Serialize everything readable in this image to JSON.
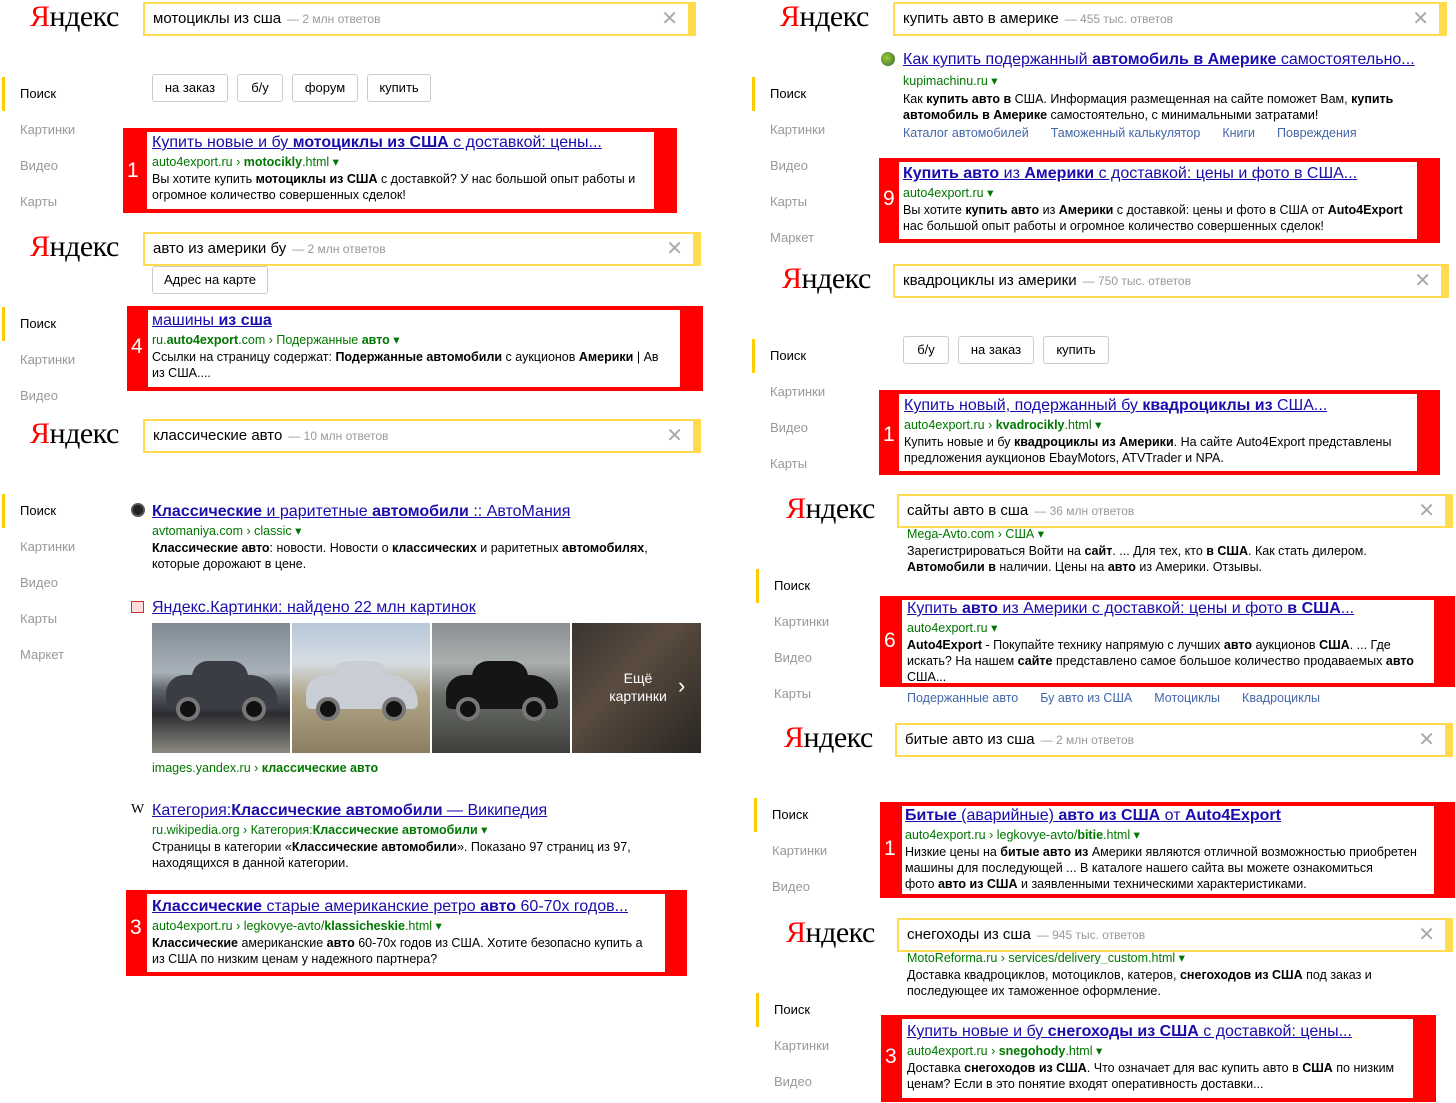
{
  "brand": {
    "logo": "Яндекс",
    "logo_first": "Я",
    "logo_rest": "ндекс"
  },
  "nav": {
    "search": "Поиск",
    "images": "Картинки",
    "video": "Видео",
    "maps": "Карты",
    "market": "Маркет"
  },
  "left": {
    "p1": {
      "query": "мотоциклы из сша",
      "count": "— 2 млн ответов",
      "chips": [
        "на заказ",
        "б/у",
        "форум",
        "купить"
      ],
      "res": {
        "rank": "1",
        "title_parts": [
          "Купить новые и бу ",
          "мотоциклы из США",
          " с доставкой: цены..."
        ],
        "url_parts": [
          "auto4export.ru › ",
          "motocikly",
          ".html ▾"
        ],
        "snippet1_parts": [
          "Вы хотите купить ",
          "мотоциклы из США",
          " с доставкой? У нас большой опыт работы и"
        ],
        "snippet2": "огромное количество совершенных сделок!"
      }
    },
    "p2": {
      "query": "авто из америки бу",
      "count": "— 2 млн ответов",
      "map_chip": "Адрес на карте",
      "res": {
        "rank": "4",
        "title_parts": [
          "машины ",
          "из сша"
        ],
        "url_parts": [
          "ru.",
          "auto4export",
          ".com › Подержанные ",
          "авто",
          " ▾"
        ],
        "snippet1_parts": [
          "Ссылки на страницу содержат: ",
          "Подержанные автомобили",
          " с аукционов ",
          "Америки",
          " | Ав"
        ],
        "snippet2": "из США...."
      }
    },
    "p3": {
      "query": "классические авто",
      "count": "— 10 млн ответов",
      "r1": {
        "title_parts": [
          "Классические",
          " и раритетные ",
          "автомобили",
          " :: АвтоМания"
        ],
        "url_parts": [
          "avtomaniya.com › classic ▾"
        ],
        "snippet1_parts": [
          "Классические авто",
          ": новости. Новости о ",
          "классических",
          " и раритетных ",
          "автомобилях",
          ","
        ],
        "snippet2": "которые дорожают в цене."
      },
      "r2": {
        "title": "Яндекс.Картинки: найдено 22 млн картинок",
        "more": "Ещё картинки",
        "more1": "Ещё",
        "more2": "картинки",
        "url_parts": [
          "images.yandex.ru › ",
          "классические авто"
        ]
      },
      "r3": {
        "title_parts": [
          "Категория:",
          "Классические автомобили",
          " — Википедия"
        ],
        "url_parts": [
          "ru.wikipedia.org › Категория:",
          "Классические автомобили",
          " ▾"
        ],
        "snippet1_parts": [
          "Страницы в категории «",
          "Классические автомобили",
          "». Показано 97 страниц из 97,"
        ],
        "snippet2": "находящихся в данной категории."
      },
      "r4": {
        "rank": "3",
        "title_parts": [
          "Классические",
          " старые американские ретро ",
          "авто",
          " 60-70х годов..."
        ],
        "url_parts": [
          "auto4export.ru › legkovye-avto/",
          "klassicheskie",
          ".html ▾"
        ],
        "snippet1_parts": [
          "Классические",
          " американские ",
          "авто",
          " 60-70х годов из США. Хотите безопасно купить а"
        ],
        "snippet2": "из США по низким ценам у надежного партнера?"
      }
    }
  },
  "right": {
    "p1": {
      "query": "купить авто в америке",
      "count": "— 455 тыс. ответов",
      "r1": {
        "title_parts": [
          "Как купить подержанный ",
          "автомобиль в Америке",
          " самостоятельно..."
        ],
        "url": "kupimachinu.ru ▾",
        "snippet1_parts": [
          "Как ",
          "купить авто в",
          " США. Информация размещенная на сайте поможет Вам, ",
          "купить"
        ],
        "snippet2_parts": [
          "автомобиль в Америке",
          " самостоятельно, с минимальными затратами!"
        ],
        "sitelinks": [
          "Каталог автомобилей",
          "Таможенный калькулятор",
          "Книги",
          "Повреждения"
        ]
      },
      "r2": {
        "rank": "9",
        "title_parts": [
          "Купить авто",
          " из ",
          "Америки",
          " с доставкой: цены и фото в США..."
        ],
        "url_parts": [
          "auto4export.ru ▾"
        ],
        "snippet1_parts": [
          "Вы хотите ",
          "купить авто",
          " из ",
          "Америки",
          " с доставкой: цены и фото в США от ",
          "Auto4Export"
        ],
        "snippet2": "нас большой опыт работы и огромное количество совершенных сделок!"
      }
    },
    "p2": {
      "query": "квадроциклы из америки",
      "count": "— 750 тыс. ответов",
      "chips": [
        "б/у",
        "на заказ",
        "купить"
      ],
      "res": {
        "rank": "1",
        "title_parts": [
          "Купить новый, подержанный бу ",
          "квадроциклы из",
          " США..."
        ],
        "url_parts": [
          "auto4export.ru › ",
          "kvadrocikly",
          ".html ▾"
        ],
        "snippet1_parts": [
          "Купить новые и бу ",
          "квадроциклы из Америки",
          ". На сайте Auto4Export представлены"
        ],
        "snippet2": "предложения аукционов EbayMotors, ATVTrader и NPA."
      }
    },
    "p3": {
      "query": "сайты авто в сша",
      "count": "— 36 млн ответов",
      "partial_url": "Mega-Avto.com › США ▾",
      "prev1_parts": [
        "Зарегистрироваться Войти на ",
        "сайт",
        ". ... Для тех, кто ",
        "в США",
        ". Как стать дилером."
      ],
      "prev2_parts": [
        "Автомобили в",
        " наличии. Цены на ",
        "авто",
        " из Америки. Отзывы."
      ],
      "res": {
        "rank": "6",
        "title_parts": [
          "Купить ",
          "авто",
          " из Америки с доставкой: цены и фото ",
          "в США",
          "..."
        ],
        "url_parts": [
          "auto4export.ru ▾"
        ],
        "snippet1_parts": [
          "Auto4Export",
          " - Покупайте технику напрямую с лучших ",
          "авто",
          " аукционов ",
          "США",
          ". ... Где"
        ],
        "snippet2_parts": [
          "искать? На нашем ",
          "сайте",
          " представлено самое большое количество продаваемых ",
          "авто"
        ],
        "snippet3": "США...",
        "sitelinks": [
          "Подержанные авто",
          "Бу авто из США",
          "Мотоциклы",
          "Квадроциклы"
        ]
      }
    },
    "p4": {
      "query": "битые авто из сша",
      "count": "— 2 млн ответов",
      "res": {
        "rank": "1",
        "title_parts": [
          "Битые",
          " (аварийные) ",
          "авто из США",
          " от ",
          "Auto4Export"
        ],
        "url_parts": [
          "auto4export.ru › legkovye-avto/",
          "bitie",
          ".html ▾"
        ],
        "snippet1_parts": [
          "Низкие цены на ",
          "битые авто из",
          " Америки являются отличной возможностью приобретен"
        ],
        "snippet2": "машины для последующей ... В каталоге нашего сайта вы можете ознакомиться",
        "snippet3_parts": [
          "фото ",
          "авто из США",
          " и заявленными техническими характеристиками."
        ]
      }
    },
    "p5": {
      "query": "снегоходы из сша",
      "count": "— 945 тыс. ответов",
      "partial_url": "MotoReforma.ru › services/delivery_custom.html ▾",
      "prev1_parts": [
        "Доставка квадроциклов, мотоциклов, катеров, ",
        "снегоходов из США",
        " под заказ и"
      ],
      "prev2": "последующее их таможенное оформление.",
      "res": {
        "rank": "3",
        "title_parts": [
          "Купить новые и бу ",
          "снегоходы из США",
          " с доставкой: цены..."
        ],
        "url_parts": [
          "auto4export.ru › ",
          "snegohody",
          ".html ▾"
        ],
        "snippet1_parts": [
          "Доставка ",
          "снегоходов из США",
          ". Что означает для вас купить авто в ",
          "США",
          " по низким"
        ],
        "snippet2": "ценам? Если в это понятие входят оперативность доставки..."
      }
    }
  }
}
